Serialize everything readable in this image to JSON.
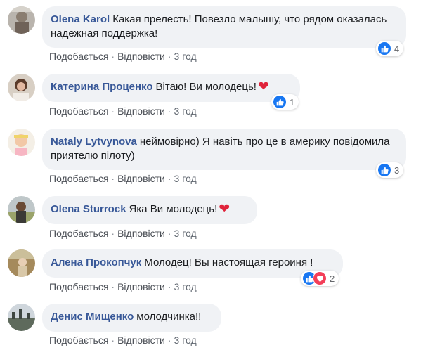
{
  "actions": {
    "like_label": "Подобається",
    "reply_label": "Відповісти",
    "separator": "·"
  },
  "colors": {
    "author_link": "#385898",
    "bubble_bg": "#f0f2f5",
    "like_blue": "#1877f2",
    "love_red": "#f33e58",
    "heart_emoji": "#e0243b"
  },
  "comments": [
    {
      "author": "Olena Karol",
      "text": "Какая прелесть! Повезло малышу, что рядом оказалась надежная поддержка!",
      "time": "3 год",
      "reaction_icons": [
        "like-icon"
      ],
      "reaction_count": "4"
    },
    {
      "author": "Катерина Проценко",
      "text": "Вітаю! Ви молодець!",
      "emoji": "❤",
      "time": "3 год",
      "reaction_icons": [
        "like-icon"
      ],
      "reaction_count": "1"
    },
    {
      "author": "Nataly Lytvynova",
      "text": "неймовірно) Я навіть про це в америку повідомила приятелю пілоту)",
      "time": "3 год",
      "reaction_icons": [
        "like-icon"
      ],
      "reaction_count": "3"
    },
    {
      "author": "Olena Sturrock",
      "text": "Яка Ви молодець!",
      "emoji": "❤",
      "time": "3 год"
    },
    {
      "author": "Алена Прокопчук",
      "text": "Молодец! Вы настоящая героиня !",
      "time": "3 год",
      "reaction_icons": [
        "like-icon",
        "love-icon"
      ],
      "reaction_count": "2"
    },
    {
      "author": "Денис Мищенко",
      "text": "молодчинка!!",
      "time": "3 год"
    }
  ]
}
